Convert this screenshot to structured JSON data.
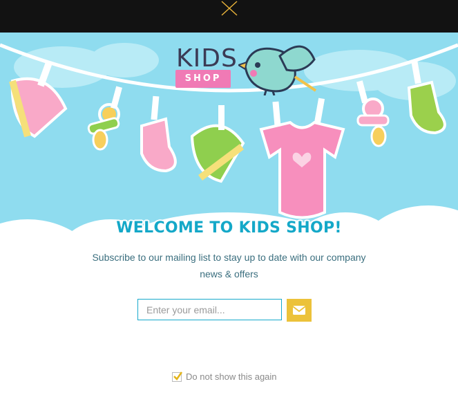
{
  "logo": {
    "word": "KIDS",
    "tag": "SHOP"
  },
  "popup": {
    "headline": "WELCOME TO KIDS SHOP!",
    "subtitle": "Subscribe to our mailing list to stay up to date with our company news & offers",
    "email_placeholder": "Enter your email...",
    "optout_label": "Do not show this again",
    "optout_checked": true
  },
  "icons": {
    "close": "close-icon",
    "submit": "envelope-icon",
    "checkbox": "checkmark-icon",
    "bird": "bird-icon"
  },
  "colors": {
    "topbar": "#121212",
    "sky": "#8fdcef",
    "accent_blue": "#14a8c8",
    "accent_pink": "#f07ab5",
    "submit_yellow": "#ecc23a"
  }
}
